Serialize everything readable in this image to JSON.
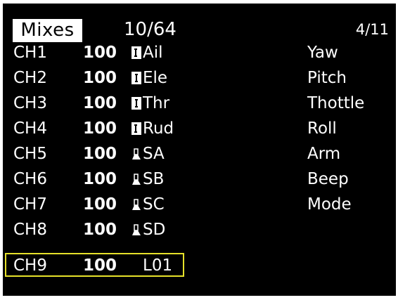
{
  "screen": {
    "title": "Mixes",
    "counter": "10/64",
    "page": "4/11"
  },
  "colors": {
    "background": "#000000",
    "text": "#ffffff",
    "title_badge": "#ffffff",
    "selection_border": "#e6e12a"
  },
  "mixes": [
    {
      "channel": "CH1",
      "weight": "100",
      "icon": "stick-icon",
      "source": "Ail",
      "name": "Yaw"
    },
    {
      "channel": "CH2",
      "weight": "100",
      "icon": "stick-icon",
      "source": "Ele",
      "name": "Pitch"
    },
    {
      "channel": "CH3",
      "weight": "100",
      "icon": "stick-icon",
      "source": "Thr",
      "name": "Thottle"
    },
    {
      "channel": "CH4",
      "weight": "100",
      "icon": "stick-icon",
      "source": "Rud",
      "name": "Roll"
    },
    {
      "channel": "CH5",
      "weight": "100",
      "icon": "switch-icon",
      "source": "SA",
      "name": "Arm"
    },
    {
      "channel": "CH6",
      "weight": "100",
      "icon": "switch-icon",
      "source": "SB",
      "name": "Beep"
    },
    {
      "channel": "CH7",
      "weight": "100",
      "icon": "switch-icon",
      "source": "SC",
      "name": "Mode"
    },
    {
      "channel": "CH8",
      "weight": "100",
      "icon": "switch-icon",
      "source": "SD",
      "name": ""
    }
  ],
  "selected_mix": {
    "channel": "CH9",
    "weight": "100",
    "source": "L01"
  }
}
